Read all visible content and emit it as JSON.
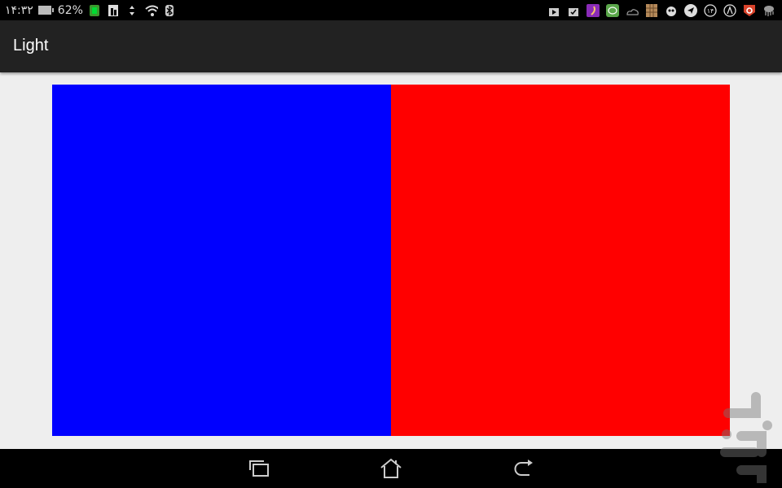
{
  "status_bar": {
    "time": "۱۴:۳۲",
    "battery_percent": "62%",
    "left_icons": [
      "battery-icon",
      "app-notification-icon",
      "sd-card-icon",
      "data-transfer-icon",
      "wifi-icon",
      "bluetooth-icon"
    ],
    "right_icons": [
      "store-download-icon",
      "store-update-icon",
      "app-purple-icon",
      "line-messenger-icon",
      "weather-icon",
      "grid-app-icon",
      "cat-app-icon",
      "telegram-icon",
      "number-14-icon",
      "a-circle-icon",
      "shield-red-icon",
      "jellyfish-icon"
    ]
  },
  "app_bar": {
    "title": "Light"
  },
  "panels": [
    {
      "name": "blue",
      "color": "#0000ff"
    },
    {
      "name": "red",
      "color": "#ff0000"
    }
  ],
  "nav_bar": {
    "buttons": [
      "recent-apps",
      "home",
      "back"
    ]
  }
}
